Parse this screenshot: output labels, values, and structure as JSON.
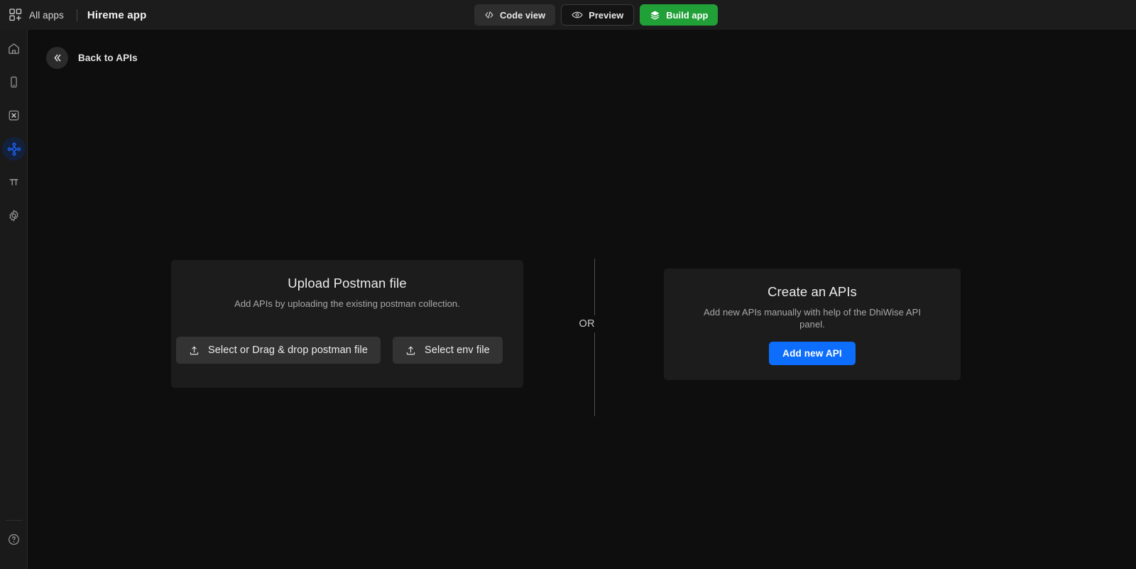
{
  "topbar": {
    "all_apps_label": "All apps",
    "all_apps_icon": "grid-plus-icon",
    "app_title": "Hireme app",
    "buttons": [
      {
        "label": "Code view",
        "icon": "code-brackets-icon",
        "style": "dark"
      },
      {
        "label": "Preview",
        "icon": "eye-icon",
        "style": "outline"
      },
      {
        "label": "Build app",
        "icon": "layers-stack-icon",
        "style": "green"
      }
    ],
    "accent_green": "#21a038"
  },
  "sidebar": {
    "items": [
      {
        "name": "home",
        "icon": "home-icon",
        "active": false
      },
      {
        "name": "screens",
        "icon": "mobile-device-icon",
        "active": false
      },
      {
        "name": "data-models",
        "icon": "x-box-icon",
        "active": false
      },
      {
        "name": "apis",
        "icon": "api-node-icon",
        "active": true
      },
      {
        "name": "constants",
        "icon": "pi-icon",
        "active": false
      },
      {
        "name": "settings",
        "icon": "gear-icon",
        "active": false
      }
    ],
    "help": {
      "name": "help",
      "icon": "question-circle-icon"
    },
    "active_color": "#1a62f0",
    "active_bg": "#14213d"
  },
  "main": {
    "back": {
      "label": "Back to APIs",
      "icon": "chevron-double-left-icon"
    },
    "divider_label": "OR",
    "upload_card": {
      "title": "Upload Postman file",
      "subtitle": "Add APIs by uploading the existing postman collection.",
      "buttons": [
        {
          "label": "Select or Drag & drop postman file",
          "icon": "upload-icon"
        },
        {
          "label": "Select env file",
          "icon": "upload-icon"
        }
      ]
    },
    "create_card": {
      "title": "Create an APIs",
      "subtitle": "Add new APIs manually with help of the DhiWise API panel.",
      "button": {
        "label": "Add new API",
        "color": "#0d6efd"
      }
    }
  }
}
